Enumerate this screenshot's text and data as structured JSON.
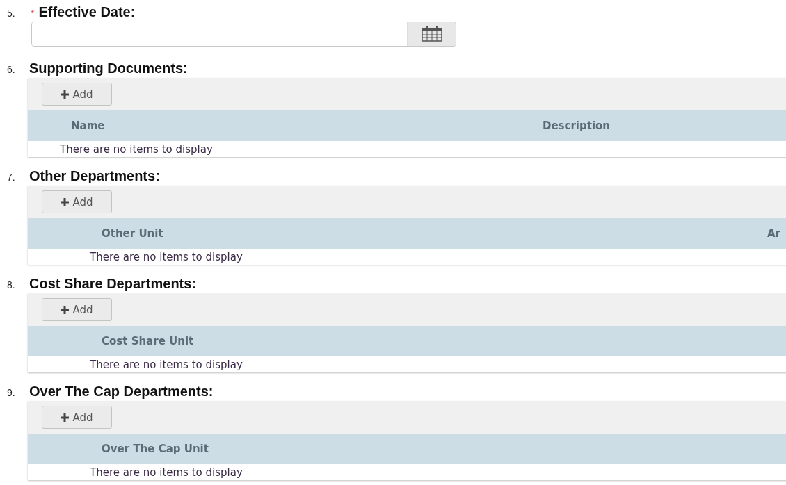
{
  "date_question": {
    "number": "5.",
    "required_mark": "*",
    "title": "Effective Date:"
  },
  "sections": [
    {
      "number": "6.",
      "title": "Supporting Documents:",
      "add_button": "Add",
      "kind": "documents",
      "columns": [
        "Name",
        "Description"
      ],
      "empty_text": "There are no items to display"
    },
    {
      "number": "7.",
      "title": "Other Departments:",
      "add_button": "Add",
      "kind": "departments",
      "columns": [
        "Other Unit",
        "Ar"
      ],
      "empty_text": "There are no items to display"
    },
    {
      "number": "8.",
      "title": "Cost Share Departments:",
      "add_button": "Add",
      "kind": "departments",
      "columns": [
        "Cost Share Unit"
      ],
      "empty_text": "There are no items to display"
    },
    {
      "number": "9.",
      "title": "Over The Cap Departments:",
      "add_button": "Add",
      "kind": "departments",
      "columns": [
        "Over The Cap Unit"
      ],
      "empty_text": "There are no items to display"
    }
  ]
}
